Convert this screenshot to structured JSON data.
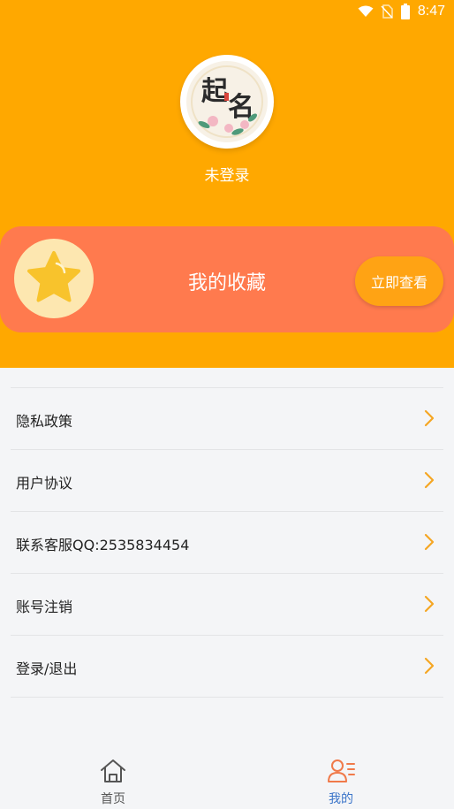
{
  "status_bar": {
    "time": "8:47"
  },
  "profile": {
    "login_status": "未登录",
    "avatar_text_top": "起",
    "avatar_text_bottom": "名"
  },
  "favorites": {
    "title": "我的收藏",
    "button_label": "立即查看"
  },
  "menu": {
    "items": [
      {
        "label": "隐私政策"
      },
      {
        "label": "用户协议"
      },
      {
        "label": "联系客服QQ:2535834454"
      },
      {
        "label": "账号注销"
      },
      {
        "label": "登录/退出"
      }
    ]
  },
  "tabs": [
    {
      "label": "首页",
      "icon": "home-icon",
      "active": false
    },
    {
      "label": "我的",
      "icon": "profile-icon",
      "active": true
    }
  ],
  "colors": {
    "header": "#ffa800",
    "card": "#ff7a4e",
    "button": "#ffa314",
    "chevron": "#f5a623",
    "tab_active": "#3a74c9",
    "tab_inactive": "#555555",
    "tab_active_icon": "#f07a4a"
  }
}
